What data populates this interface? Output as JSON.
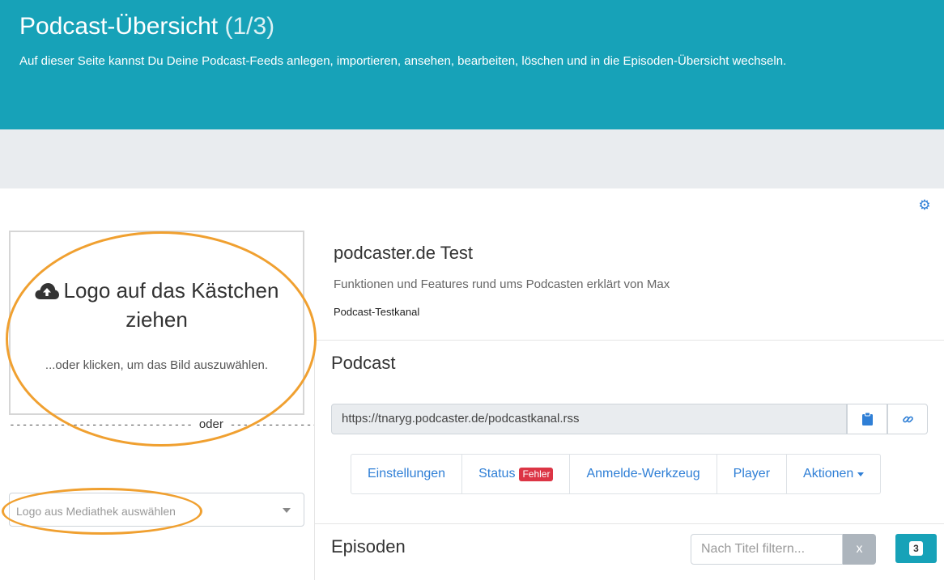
{
  "header": {
    "title": "Podcast-Übersicht",
    "page_count": "(1/3)",
    "description": "Auf dieser Seite kannst Du Deine Podcast-Feeds anlegen, importieren, ansehen, bearbeiten, löschen und in die Episoden-Übersicht wechseln."
  },
  "logo": {
    "dropzone_title": "Logo auf das Kästchen ziehen",
    "dropzone_subtitle": "...oder klicken, um das Bild auszuwählen.",
    "separator_word": "oder",
    "media_select_placeholder": "Logo aus Mediathek auswählen"
  },
  "feed": {
    "title": "podcaster.de Test",
    "description": "Funktionen und Features rund ums Podcasten erklärt von Max",
    "channel": "Podcast-Testkanal"
  },
  "podcast_section": {
    "heading": "Podcast",
    "feed_url": "https://tnaryg.podcaster.de/podcastkanal.rss"
  },
  "tabs": [
    {
      "label": "Einstellungen"
    },
    {
      "label": "Status",
      "badge": "Fehler"
    },
    {
      "label": "Anmelde-Werkzeug"
    },
    {
      "label": "Player"
    },
    {
      "label": "Aktionen"
    }
  ],
  "episodes_section": {
    "heading": "Episoden",
    "filter_placeholder": "Nach Titel filtern...",
    "clear_label": "x",
    "count": "3"
  },
  "colors": {
    "header_bg": "#17a2b8",
    "link": "#2f7fd6",
    "error_badge": "#dc3545",
    "annotation": "#f0a030"
  }
}
